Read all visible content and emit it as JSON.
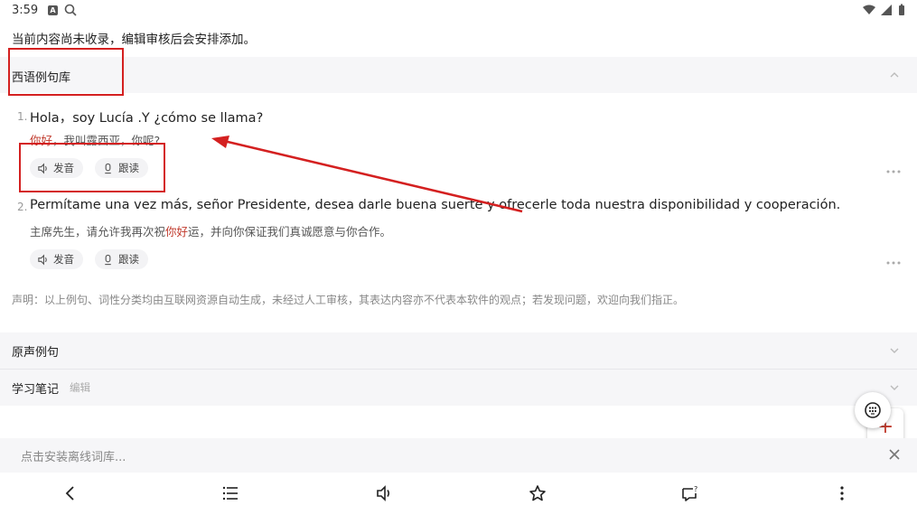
{
  "status": {
    "time": "3:59",
    "icon_a": "A"
  },
  "notice": "当前内容尚未收录，编辑审核后会安排添加。",
  "section": {
    "title": "西语例句库"
  },
  "sentences": [
    {
      "num": "1.",
      "es": "Hola，soy Lucía .Y ¿cómo se llama?",
      "zh_hl": "你好",
      "zh_rest": "，我叫露西亚，你呢?",
      "btn_speak": "发音",
      "btn_read": "跟读"
    },
    {
      "num": "2.",
      "es": "Permítame una vez más, señor Presidente, desea darle buena suerte y ofrecerle toda nuestra disponibilidad y cooperación.",
      "zh_pre": "主席先生，请允许我再次祝",
      "zh_hl": "你好",
      "zh_post": "运，并向你保证我们真诚愿意与你合作。",
      "btn_speak": "发音",
      "btn_read": "跟读"
    }
  ],
  "disclaimer": "声明：以上例句、词性分类均由互联网资源自动生成，未经过人工审核，其表达内容亦不代表本软件的观点；若发现问题，欢迎向我们指正。",
  "original_examples": {
    "title": "原声例句"
  },
  "study_notes": {
    "title": "学习笔记",
    "edit": "编辑"
  },
  "fab": {
    "plus": "+"
  },
  "install": {
    "text": "点击安装离线词库..."
  },
  "nav": [
    "back-icon",
    "list-icon",
    "speaker-icon",
    "star-icon",
    "feedback-icon",
    "more-vertical-icon"
  ],
  "colors": {
    "highlight": "#c0392b",
    "annotation": "#d42020",
    "band": "#f6f6f8"
  }
}
